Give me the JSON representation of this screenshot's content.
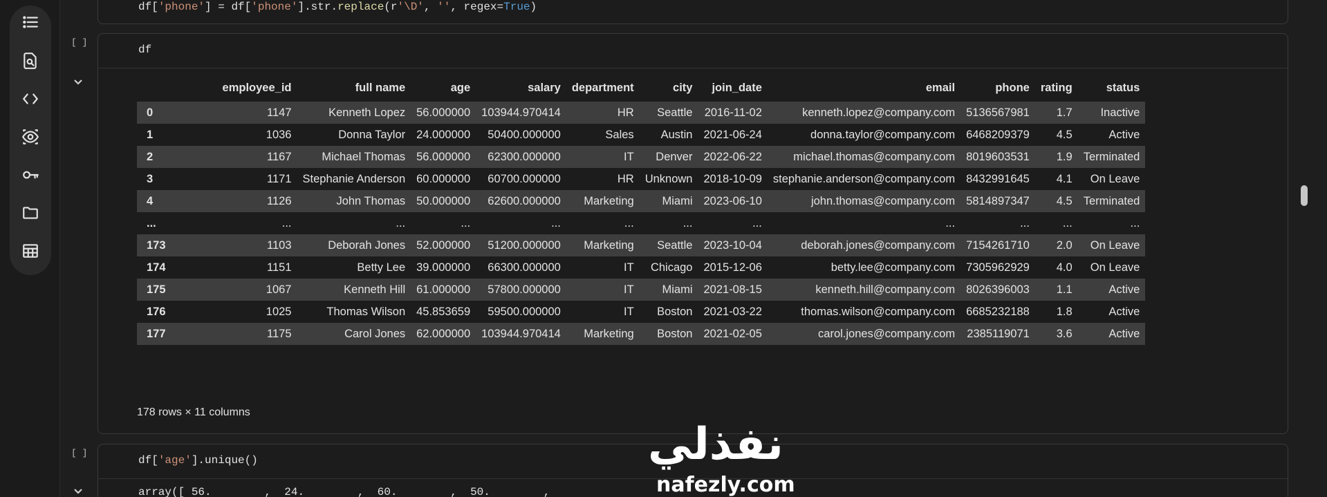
{
  "cells": {
    "prev_code": {
      "part1": "df[",
      "part2": "'phone'",
      "part3": "] = df[",
      "part4": "'phone'",
      "part5": "].str.",
      "part6": "replace",
      "part7": "(r",
      "part8": "'\\D'",
      "part9": ", ",
      "part10": "''",
      "part11": ", regex=",
      "part12": "True",
      "part13": ")"
    },
    "df_cell": {
      "bracket": "[ ]",
      "code": "df"
    },
    "unique_cell": {
      "bracket": "[ ]",
      "code_a": "df[",
      "code_b": "'age'",
      "code_c": "].unique()",
      "output": "array([ 56.        ,  24.        ,  60.        ,  50.        ,"
    }
  },
  "dataframe": {
    "columns": [
      "",
      "employee_id",
      "full name",
      "age",
      "salary",
      "department",
      "city",
      "join_date",
      "email",
      "phone",
      "rating",
      "status"
    ],
    "rows": [
      [
        "0",
        "1147",
        "Kenneth Lopez",
        "56.000000",
        "103944.970414",
        "HR",
        "Seattle",
        "2016-11-02",
        "kenneth.lopez@company.com",
        "5136567981",
        "1.7",
        "Inactive"
      ],
      [
        "1",
        "1036",
        "Donna Taylor",
        "24.000000",
        "50400.000000",
        "Sales",
        "Austin",
        "2021-06-24",
        "donna.taylor@company.com",
        "6468209379",
        "4.5",
        "Active"
      ],
      [
        "2",
        "1167",
        "Michael Thomas",
        "56.000000",
        "62300.000000",
        "IT",
        "Denver",
        "2022-06-22",
        "michael.thomas@company.com",
        "8019603531",
        "1.9",
        "Terminated"
      ],
      [
        "3",
        "1171",
        "Stephanie Anderson",
        "60.000000",
        "60700.000000",
        "HR",
        "Unknown",
        "2018-10-09",
        "stephanie.anderson@company.com",
        "8432991645",
        "4.1",
        "On Leave"
      ],
      [
        "4",
        "1126",
        "John Thomas",
        "50.000000",
        "62600.000000",
        "Marketing",
        "Miami",
        "2023-06-10",
        "john.thomas@company.com",
        "5814897347",
        "4.5",
        "Terminated"
      ],
      [
        "...",
        "...",
        "...",
        "...",
        "...",
        "...",
        "...",
        "...",
        "...",
        "...",
        "...",
        "..."
      ],
      [
        "173",
        "1103",
        "Deborah Jones",
        "52.000000",
        "51200.000000",
        "Marketing",
        "Seattle",
        "2023-10-04",
        "deborah.jones@company.com",
        "7154261710",
        "2.0",
        "On Leave"
      ],
      [
        "174",
        "1151",
        "Betty Lee",
        "39.000000",
        "66300.000000",
        "IT",
        "Chicago",
        "2015-12-06",
        "betty.lee@company.com",
        "7305962929",
        "4.0",
        "On Leave"
      ],
      [
        "175",
        "1067",
        "Kenneth Hill",
        "61.000000",
        "57800.000000",
        "IT",
        "Miami",
        "2021-08-15",
        "kenneth.hill@company.com",
        "8026396003",
        "1.1",
        "Active"
      ],
      [
        "176",
        "1025",
        "Thomas Wilson",
        "45.853659",
        "59500.000000",
        "IT",
        "Boston",
        "2021-03-22",
        "thomas.wilson@company.com",
        "6685232188",
        "1.8",
        "Active"
      ],
      [
        "177",
        "1175",
        "Carol Jones",
        "62.000000",
        "103944.970414",
        "Marketing",
        "Boston",
        "2021-02-05",
        "carol.jones@company.com",
        "2385119071",
        "3.6",
        "Active"
      ]
    ],
    "shape_text": "178 rows × 11 columns"
  },
  "watermark": {
    "arabic": "نفذلي",
    "latin": "nafezly.com"
  },
  "icons": [
    "list-icon",
    "search-doc-icon",
    "code-icon",
    "eye-icon",
    "key-icon",
    "folder-icon",
    "table-icon",
    "chevron-down-icon"
  ]
}
